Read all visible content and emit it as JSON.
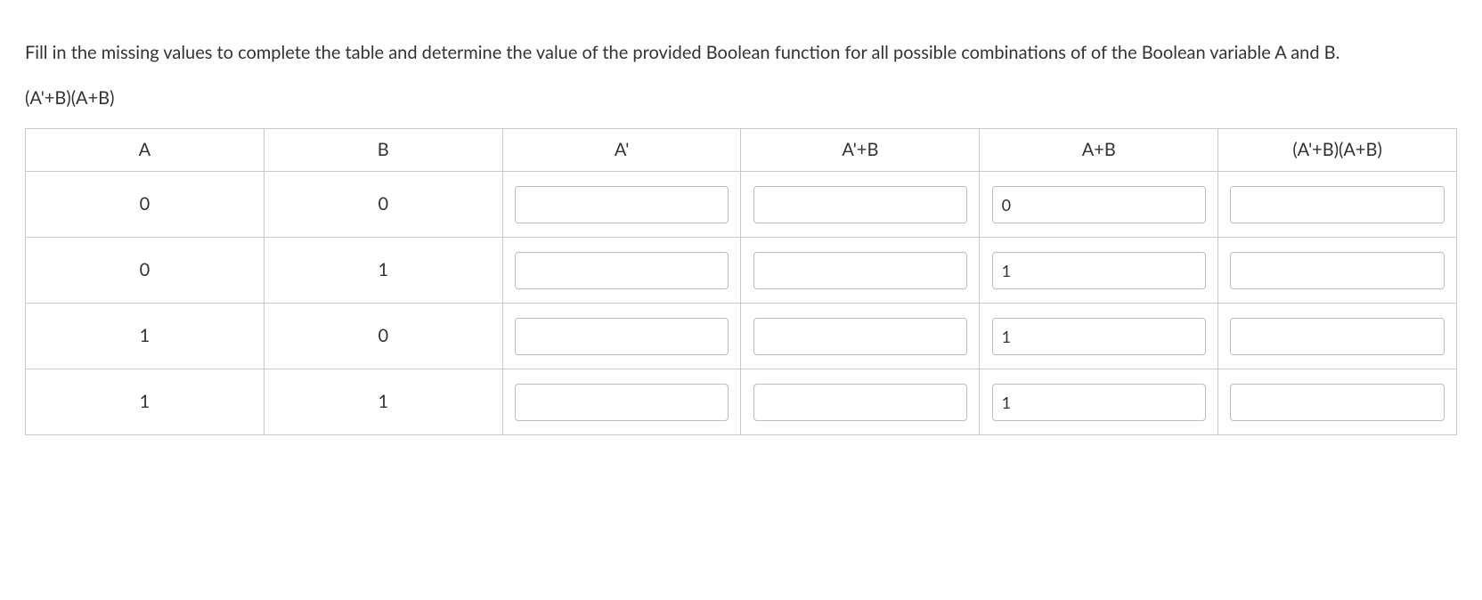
{
  "prompt": "Fill in the missing values to complete the table and determine the value of the provided Boolean function for all possible combinations of of the Boolean variable A and B.",
  "expression": "(A'+B)(A+B)",
  "headers": [
    "A",
    "B",
    "A'",
    "A'+B",
    "A+B",
    "(A'+B)(A+B)"
  ],
  "rows": [
    {
      "A": "0",
      "B": "0",
      "Aprime": "",
      "AprimeB": "",
      "AplusB": "0",
      "result": ""
    },
    {
      "A": "0",
      "B": "1",
      "Aprime": "",
      "AprimeB": "",
      "AplusB": "1",
      "result": ""
    },
    {
      "A": "1",
      "B": "0",
      "Aprime": "",
      "AprimeB": "",
      "AplusB": "1",
      "result": ""
    },
    {
      "A": "1",
      "B": "1",
      "Aprime": "",
      "AprimeB": "",
      "AplusB": "1",
      "result": ""
    }
  ]
}
